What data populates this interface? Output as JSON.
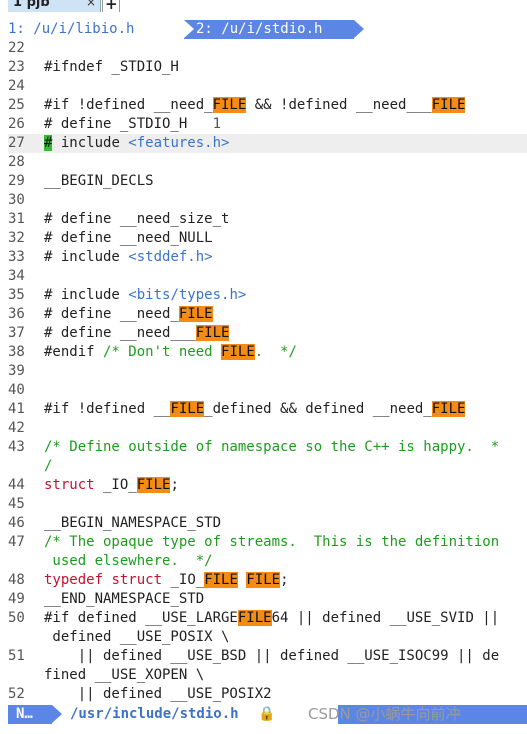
{
  "tab": {
    "title": "1 pjb",
    "close": "×",
    "new": "+"
  },
  "buffers": [
    {
      "label": "1: /u/i/libio.h"
    },
    {
      "label": "2: /u/i/stdio.h"
    }
  ],
  "code_lines": [
    {
      "n": "22",
      "segs": []
    },
    {
      "n": "23",
      "segs": [
        {
          "t": "#ifndef _STDIO_H",
          "c": ""
        }
      ]
    },
    {
      "n": "24",
      "segs": []
    },
    {
      "n": "25",
      "segs": [
        {
          "t": "#if !defined __need_",
          "c": ""
        },
        {
          "t": "FILE",
          "c": "hl"
        },
        {
          "t": " && !defined __need___",
          "c": ""
        },
        {
          "t": "FILE",
          "c": "hl"
        }
      ]
    },
    {
      "n": "26",
      "segs": [
        {
          "t": "# define _STDIO_H   ",
          "c": ""
        },
        {
          "t": "1",
          "c": "num"
        }
      ]
    },
    {
      "n": "27",
      "cursor": true,
      "segs": [
        {
          "t": "#",
          "c": "cur"
        },
        {
          "t": " include ",
          "c": ""
        },
        {
          "t": "<features.h>",
          "c": "str"
        }
      ]
    },
    {
      "n": "28",
      "segs": []
    },
    {
      "n": "29",
      "segs": [
        {
          "t": "__BEGIN_DECLS",
          "c": ""
        }
      ]
    },
    {
      "n": "30",
      "segs": []
    },
    {
      "n": "31",
      "segs": [
        {
          "t": "# define __need_size_t",
          "c": ""
        }
      ]
    },
    {
      "n": "32",
      "segs": [
        {
          "t": "# define __need_NULL",
          "c": ""
        }
      ]
    },
    {
      "n": "33",
      "segs": [
        {
          "t": "# include ",
          "c": ""
        },
        {
          "t": "<stddef.h>",
          "c": "str"
        }
      ]
    },
    {
      "n": "34",
      "segs": []
    },
    {
      "n": "35",
      "segs": [
        {
          "t": "# include ",
          "c": ""
        },
        {
          "t": "<bits/types.h>",
          "c": "str"
        }
      ]
    },
    {
      "n": "36",
      "segs": [
        {
          "t": "# define __need_",
          "c": ""
        },
        {
          "t": "FILE",
          "c": "hl"
        }
      ]
    },
    {
      "n": "37",
      "segs": [
        {
          "t": "# define __need___",
          "c": ""
        },
        {
          "t": "FILE",
          "c": "hl"
        }
      ]
    },
    {
      "n": "38",
      "segs": [
        {
          "t": "#endif ",
          "c": ""
        },
        {
          "t": "/* Don't need ",
          "c": "cm"
        },
        {
          "t": "FILE",
          "c": "hl"
        },
        {
          "t": ".  */",
          "c": "cm"
        }
      ]
    },
    {
      "n": "39",
      "segs": []
    },
    {
      "n": "40",
      "segs": []
    },
    {
      "n": "41",
      "segs": [
        {
          "t": "#if !defined __",
          "c": ""
        },
        {
          "t": "FILE",
          "c": "hl"
        },
        {
          "t": "_defined && defined __need_",
          "c": ""
        },
        {
          "t": "FILE",
          "c": "hl"
        }
      ]
    },
    {
      "n": "42",
      "segs": []
    },
    {
      "n": "43",
      "segs": [
        {
          "t": "/* Define outside of namespace so the C++ is happy.  *",
          "c": "cm"
        }
      ]
    },
    {
      "n": "",
      "segs": [
        {
          "t": "/",
          "c": "cm"
        }
      ]
    },
    {
      "n": "44",
      "segs": [
        {
          "t": "struct",
          "c": "kw"
        },
        {
          "t": " _IO_",
          "c": ""
        },
        {
          "t": "FILE",
          "c": "hl"
        },
        {
          "t": ";",
          "c": ""
        }
      ]
    },
    {
      "n": "45",
      "segs": []
    },
    {
      "n": "46",
      "segs": [
        {
          "t": "__BEGIN_NAMESPACE_STD",
          "c": ""
        }
      ]
    },
    {
      "n": "47",
      "segs": [
        {
          "t": "/* The opaque type of streams.  This is the definition",
          "c": "cm"
        }
      ]
    },
    {
      "n": "",
      "segs": [
        {
          "t": " used elsewhere.  */",
          "c": "cm"
        }
      ]
    },
    {
      "n": "48",
      "segs": [
        {
          "t": "typedef",
          "c": "kw"
        },
        {
          "t": " ",
          "c": ""
        },
        {
          "t": "struct",
          "c": "kw"
        },
        {
          "t": " _IO_",
          "c": ""
        },
        {
          "t": "FILE",
          "c": "hl"
        },
        {
          "t": " ",
          "c": ""
        },
        {
          "t": "FILE",
          "c": "hl"
        },
        {
          "t": ";",
          "c": ""
        }
      ]
    },
    {
      "n": "49",
      "segs": [
        {
          "t": "__END_NAMESPACE_STD",
          "c": ""
        }
      ]
    },
    {
      "n": "50",
      "segs": [
        {
          "t": "#if defined __USE_LARGE",
          "c": ""
        },
        {
          "t": "FILE",
          "c": "hl"
        },
        {
          "t": "64 || defined __USE_SVID ||",
          "c": ""
        }
      ]
    },
    {
      "n": "",
      "segs": [
        {
          "t": " defined __USE_POSIX \\",
          "c": ""
        }
      ]
    },
    {
      "n": "51",
      "segs": [
        {
          "t": "    || defined __USE_BSD || defined __USE_ISOC99 || de",
          "c": ""
        }
      ]
    },
    {
      "n": "",
      "segs": [
        {
          "t": "fined __USE_XOPEN \\",
          "c": ""
        }
      ]
    },
    {
      "n": "52",
      "segs": [
        {
          "t": "    || defined __USE_POSIX2",
          "c": ""
        }
      ]
    }
  ],
  "status": {
    "mode": "N…",
    "filepath": "/usr/include/stdio.h",
    "lock_icon": "🔒",
    "watermark": "CSDN @小蜗牛向前冲"
  },
  "colors": {
    "keyword": "#c8102e",
    "comment": "#1f9c1f",
    "string": "#3b73c9",
    "search_highlight": "#f28c16",
    "cursor": "#2fbf2f",
    "statusbar": "#5b86e5"
  }
}
